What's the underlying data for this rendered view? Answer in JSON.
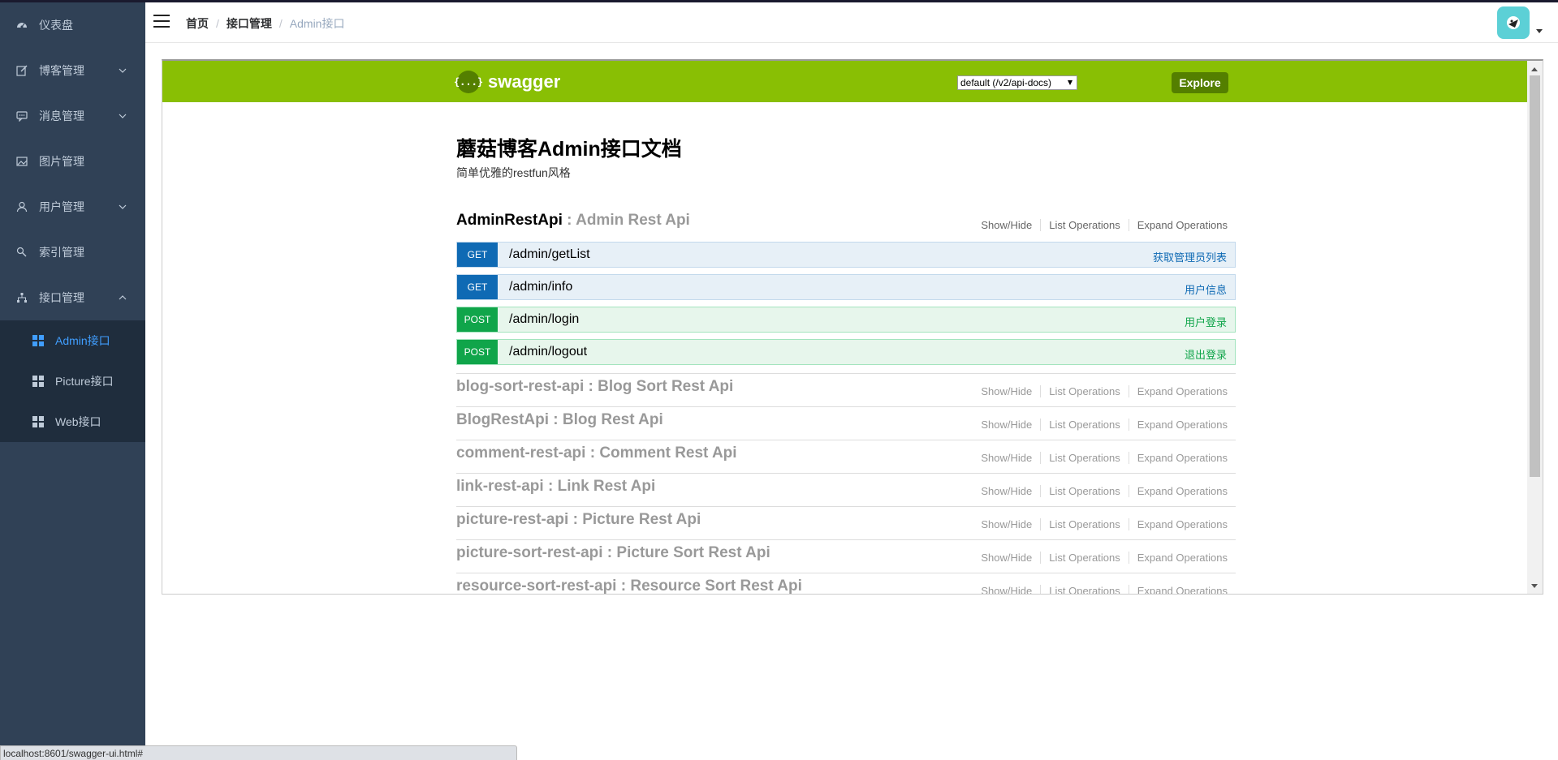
{
  "sidebar": {
    "items": [
      {
        "label": "仪表盘",
        "icon": "dashboard-icon",
        "has_children": false
      },
      {
        "label": "博客管理",
        "icon": "edit-icon",
        "has_children": true
      },
      {
        "label": "消息管理",
        "icon": "message-icon",
        "has_children": true
      },
      {
        "label": "图片管理",
        "icon": "picture-icon",
        "has_children": false
      },
      {
        "label": "用户管理",
        "icon": "user-icon",
        "has_children": true
      },
      {
        "label": "索引管理",
        "icon": "search-index-icon",
        "has_children": false
      },
      {
        "label": "接口管理",
        "icon": "sitemap-icon",
        "has_children": true,
        "expanded": true
      }
    ],
    "subitems": [
      {
        "label": "Admin接口",
        "active": true
      },
      {
        "label": "Picture接口",
        "active": false
      },
      {
        "label": "Web接口",
        "active": false
      }
    ]
  },
  "header": {
    "breadcrumb": [
      "首页",
      "接口管理",
      "Admin接口"
    ],
    "separator": "/"
  },
  "swagger": {
    "logo_text": "swagger",
    "logo_glyph": "{...}",
    "spec_select_value": "default (/v2/api-docs)",
    "explore_label": "Explore",
    "title": "蘑菇博客Admin接口文档",
    "description": "简单优雅的restfun风格",
    "links": {
      "show_hide": "Show/Hide",
      "list_ops": "List Operations",
      "expand_ops": "Expand Operations"
    },
    "resources": [
      {
        "name": "AdminRestApi",
        "desc": "Admin Rest Api"
      },
      {
        "name": "blog-sort-rest-api",
        "desc": "Blog Sort Rest Api"
      },
      {
        "name": "BlogRestApi",
        "desc": "Blog Rest Api"
      },
      {
        "name": "comment-rest-api",
        "desc": "Comment Rest Api"
      },
      {
        "name": "link-rest-api",
        "desc": "Link Rest Api"
      },
      {
        "name": "picture-rest-api",
        "desc": "Picture Rest Api"
      },
      {
        "name": "picture-sort-rest-api",
        "desc": "Picture Sort Rest Api"
      },
      {
        "name": "resource-sort-rest-api",
        "desc": "Resource Sort Rest Api"
      }
    ],
    "operations": [
      {
        "method": "GET",
        "path": "/admin/getList",
        "summary": "获取管理员列表"
      },
      {
        "method": "GET",
        "path": "/admin/info",
        "summary": "用户信息"
      },
      {
        "method": "POST",
        "path": "/admin/login",
        "summary": "用户登录"
      },
      {
        "method": "POST",
        "path": "/admin/logout",
        "summary": "退出登录"
      }
    ],
    "colors": {
      "header_bg": "#89bf04",
      "get": "#0f6ab4",
      "post": "#10a54a"
    }
  },
  "statusbar": {
    "url": "localhost:8601/swagger-ui.html#"
  },
  "theme": {
    "sidebar_bg": "#304156",
    "submenu_bg": "#1f2d3d",
    "active": "#409eff",
    "text": "#bfcbd9"
  }
}
